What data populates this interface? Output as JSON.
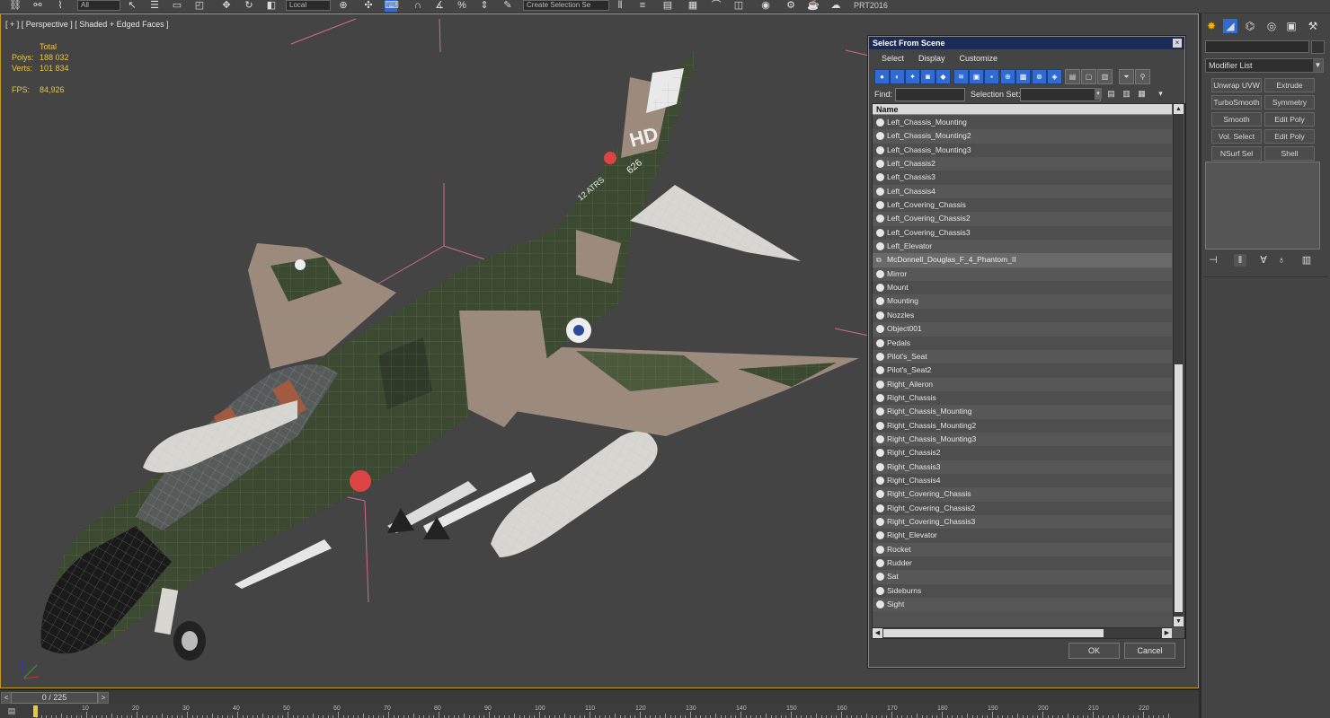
{
  "toolbar": {
    "filter_value": "All",
    "coord_value": "Local",
    "selection_set_value": "Create Selection Se",
    "app_label": "PRT2016"
  },
  "viewport": {
    "label": "[ + ] [ Perspective ] [ Shaded + Edged Faces ]",
    "stats": {
      "header": "Total",
      "polys_label": "Polys:",
      "polys_value": "188 032",
      "verts_label": "Verts:",
      "verts_value": "101 834",
      "fps_label": "FPS:",
      "fps_value": "84,926"
    },
    "aircraft_markings": {
      "tail_code": "HD",
      "tail_number": "626",
      "tail_text": "12 ATRS"
    }
  },
  "command_panel": {
    "modifier_list_label": "Modifier List",
    "modifier_buttons": [
      "Unwrap UVW",
      "Extrude",
      "TurboSmooth",
      "Symmetry",
      "Smooth",
      "Edit Poly",
      "Vol. Select",
      "Edit Poly",
      "NSurf Sel",
      "Shell"
    ]
  },
  "timeline": {
    "frame_label": "0 / 225",
    "prev": "<",
    "next": ">",
    "ruler_numbers": [
      "0",
      "10",
      "20",
      "30",
      "40",
      "50",
      "60",
      "70",
      "80",
      "90",
      "100",
      "110",
      "120",
      "130",
      "140",
      "150",
      "160",
      "170",
      "180",
      "190",
      "200",
      "210",
      "220"
    ]
  },
  "dialog": {
    "title": "Select From Scene",
    "close": "×",
    "menu": [
      "Select",
      "Display",
      "Customize"
    ],
    "find_label": "Find:",
    "selection_set_label": "Selection Set:",
    "column_header": "Name",
    "rows": [
      "Left_Chassis_Mounting",
      "Left_Chassis_Mounting2",
      "Left_Chassis_Mounting3",
      "Left_Chassis2",
      "Left_Chassis3",
      "Left_Chassis4",
      "Left_Covering_Chassis",
      "Left_Covering_Chassis2",
      "Left_Covering_Chassis3",
      "Left_Elevator",
      "McDonnell_Douglas_F_4_Phantom_II",
      "Mirror",
      "Mount",
      "Mounting",
      "Nozzles",
      "Object001",
      "Pedals",
      "Pilot's_Seat",
      "Pilot's_Seat2",
      "Right_Aileron",
      "Right_Chassis",
      "Right_Chassis_Mounting",
      "Right_Chassis_Mounting2",
      "Right_Chassis_Mounting3",
      "Right_Chassis2",
      "Right_Chassis3",
      "Right_Chassis4",
      "Right_Covering_Chassis",
      "Right_Covering_Chassis2",
      "Right_Covering_Chassis3",
      "Right_Elevator",
      "Rocket",
      "Rudder",
      "Sat",
      "Sideburns",
      "Sight"
    ],
    "selected_row": "McDonnell_Douglas_F_4_Phantom_II",
    "ok_label": "OK",
    "cancel_label": "Cancel"
  },
  "colors": {
    "viewport_bg": "#444444",
    "active_border": "#c49a1c",
    "stats_text": "#e8c547",
    "dialog_title_bg": "#1a2b55",
    "icon_blue": "#2f6bd2",
    "camo_dark": "#3d4a32",
    "camo_tan": "#9c8b7c"
  }
}
